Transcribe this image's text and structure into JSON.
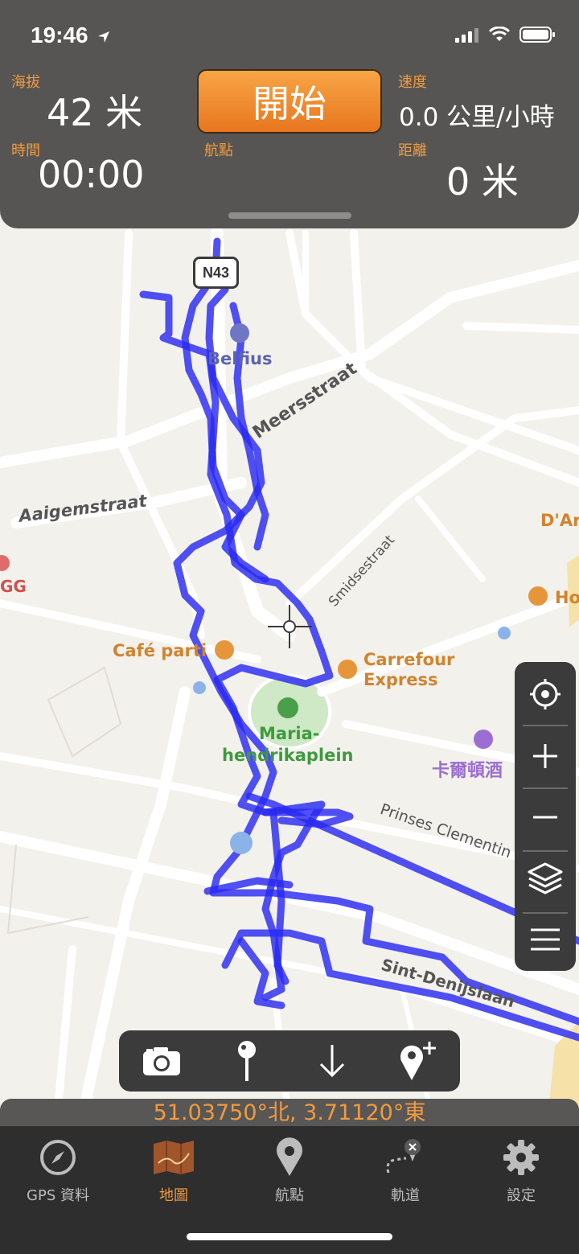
{
  "status_bar": {
    "time": "19:46"
  },
  "stats": {
    "altitude_label": "海拔",
    "altitude_value": "42 米",
    "speed_label": "速度",
    "speed_value": "0.0 公里/小時",
    "time_label": "時間",
    "time_value": "00:00",
    "waypoint_label": "航點",
    "distance_label": "距離",
    "distance_value": "0 米",
    "start_label": "開始"
  },
  "map_labels": {
    "road_shield": "N43",
    "belfius": "Belfius",
    "meersstraat": "Meersstraat",
    "aaigemstraat": "Aaigemstraat",
    "smidsestraat": "Smidsestraat",
    "cafe": "Café parti",
    "carrefour_1": "Carrefour",
    "carrefour_2": "Express",
    "park_1": "Maria-",
    "park_2": "hendrikaplein",
    "hotel": "卡爾頓酒",
    "prinses": "Prinses Clementin",
    "sint_denijslaan": "Sint-Denijslaan",
    "d_ar": "D'Ar",
    "ho": "Ho",
    "gg": "GG"
  },
  "coordinates": "51.03750°北, 3.71120°東",
  "tabs": [
    {
      "label": "GPS 資料",
      "icon": "compass-icon",
      "active": false
    },
    {
      "label": "地圖",
      "icon": "map-icon",
      "active": true
    },
    {
      "label": "航點",
      "icon": "pin-icon",
      "active": false
    },
    {
      "label": "軌道",
      "icon": "track-icon",
      "active": false
    },
    {
      "label": "設定",
      "icon": "gear-icon",
      "active": false
    }
  ],
  "colors": {
    "accent": "#f19a3e",
    "track": "#2a2af2",
    "panel": "#565553"
  }
}
